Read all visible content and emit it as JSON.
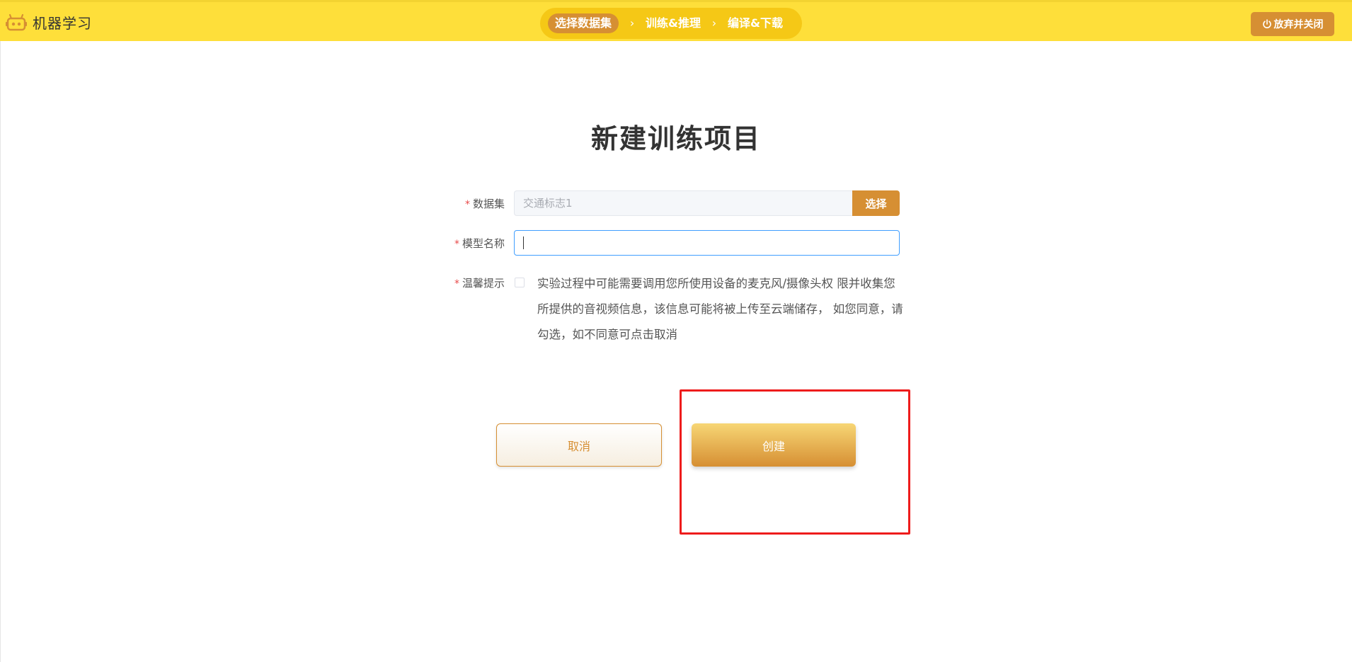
{
  "header": {
    "app_title": "机器学习",
    "steps": [
      {
        "label": "选择数据集",
        "active": true
      },
      {
        "label": "训练&推理",
        "active": false
      },
      {
        "label": "编译&下载",
        "active": false
      }
    ],
    "step_separator": "›",
    "quit_label": "放弃并关闭"
  },
  "form": {
    "title": "新建训练项目",
    "required_mark": "*",
    "dataset": {
      "label": "数据集",
      "placeholder": "交通标志1",
      "select_label": "选择"
    },
    "model_name": {
      "label": "模型名称",
      "value": "",
      "placeholder": ""
    },
    "notice": {
      "label": "温馨提示",
      "text": "实验过程中可能需要调用您所使用设备的麦克风/摄像头权 限并收集您所提供的音视频信息，该信息可能将被上传至云端储存， 如您同意，请勾选，如不同意可点击取消",
      "checked": false
    },
    "cancel_label": "取消",
    "create_label": "创建"
  },
  "colors": {
    "topbar": "#fedf3a",
    "steps_bg": "#f5c816",
    "accent": "#d68f33",
    "focus": "#409eff",
    "highlight": "#ee1c1c"
  },
  "icons": {
    "logo": "robot-icon",
    "quit": "power-icon"
  }
}
